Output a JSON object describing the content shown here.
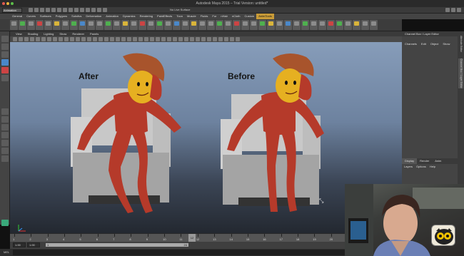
{
  "window": {
    "title": "Autodesk Maya 2015 – Trial Version: untitled*"
  },
  "toolbar": {
    "mode": "Animation",
    "live_surface": "No Live Surface"
  },
  "shelf_tabs": [
    {
      "label": "General",
      "active": false
    },
    {
      "label": "Curves",
      "active": false
    },
    {
      "label": "Surfaces",
      "active": false
    },
    {
      "label": "Polygons",
      "active": false
    },
    {
      "label": "Subdivs",
      "active": false
    },
    {
      "label": "Deformation",
      "active": false
    },
    {
      "label": "Animation",
      "active": false
    },
    {
      "label": "Dynamics",
      "active": false
    },
    {
      "label": "Rendering",
      "active": false
    },
    {
      "label": "PaintEffects",
      "active": false
    },
    {
      "label": "Toon",
      "active": false
    },
    {
      "label": "Muscle",
      "active": false
    },
    {
      "label": "Fluids",
      "active": false
    },
    {
      "label": "Fur",
      "active": false
    },
    {
      "label": "nHair",
      "active": false
    },
    {
      "label": "nCloth",
      "active": false
    },
    {
      "label": "Custom",
      "active": false
    },
    {
      "label": "AnimTools",
      "active": true
    }
  ],
  "viewport": {
    "panel_menu": [
      "View",
      "Shading",
      "Lighting",
      "Show",
      "Renderer",
      "Panels"
    ],
    "label_after": "After",
    "label_before": "Before"
  },
  "right_panel": {
    "header": "Channel Box / Layer Editor",
    "menu": [
      "Channels",
      "Edit",
      "Object",
      "Show"
    ],
    "layer_tabs": [
      "Display",
      "Render",
      "Anim"
    ],
    "layer_menu": [
      "Layers",
      "Options",
      "Help"
    ],
    "side_tabs": [
      "Attribute Editor",
      "Channel Box / Layer Editor"
    ]
  },
  "timeline": {
    "ticks": [
      "1",
      "2",
      "3",
      "4",
      "5",
      "6",
      "7",
      "8",
      "9",
      "10",
      "11",
      "12",
      "13",
      "14",
      "15",
      "16",
      "17",
      "18",
      "19",
      "20",
      "21",
      "22",
      "23",
      "24"
    ],
    "current": "12"
  },
  "range": {
    "start_field": "1.00",
    "start_field2": "1.00",
    "slider_start": "1",
    "slider_end": "24"
  },
  "command": {
    "mel_label": "MEL"
  },
  "colors": {
    "active_tab": "#c89b38",
    "character_skin": "#b53a2a",
    "face": "#e6b021",
    "chair": "#a4a4a4"
  }
}
